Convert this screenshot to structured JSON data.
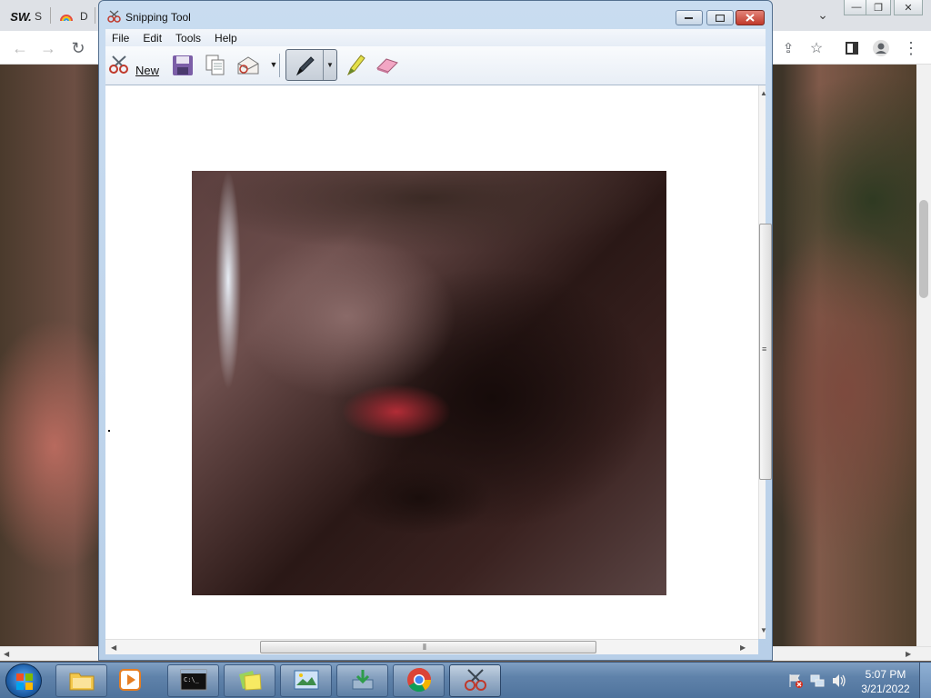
{
  "browser": {
    "tabs": [
      {
        "favicon": "SW.",
        "label": "S"
      },
      {
        "favicon": "rainbow-icon",
        "label": "D"
      }
    ],
    "window_controls": {
      "minimize": "—",
      "restore": "❐",
      "close": "✕"
    }
  },
  "snipping_tool": {
    "title": "Snipping Tool",
    "menu": [
      "File",
      "Edit",
      "Tools",
      "Help"
    ],
    "toolbar": {
      "new_label": "New",
      "icons": [
        "scissors-icon",
        "save-icon",
        "copy-icon",
        "send-email-icon",
        "pen-icon",
        "highlighter-icon",
        "eraser-icon"
      ]
    },
    "canvas": {
      "image_description_icon": "captured-snip-image"
    }
  },
  "taskbar": {
    "apps": [
      "explorer-icon",
      "media-player-icon",
      "cmd-icon",
      "sticky-notes-icon",
      "image-viewer-icon",
      "download-icon",
      "chrome-icon",
      "snipping-tool-icon"
    ],
    "clock_time": "5:07 PM",
    "clock_date": "3/21/2022"
  }
}
